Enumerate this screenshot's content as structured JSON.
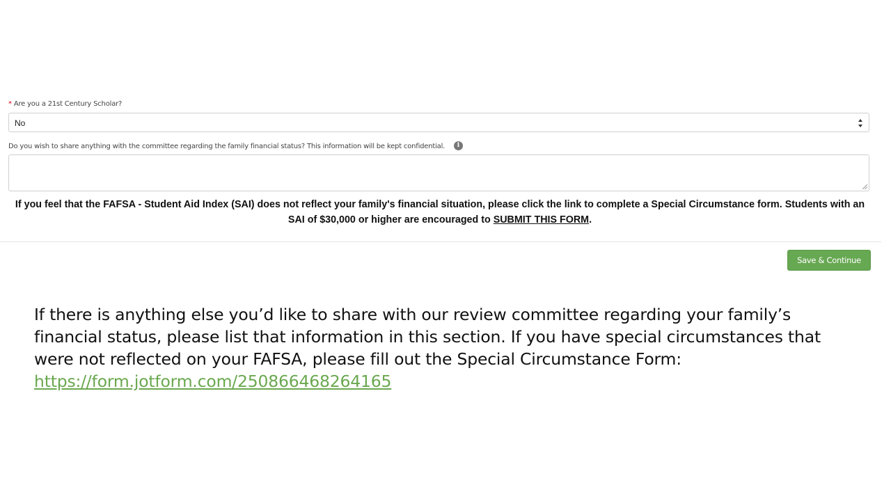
{
  "form": {
    "scholar_question": {
      "required_mark": "*",
      "label": "Are you a 21st Century Scholar?",
      "selected_value": "No"
    },
    "share_question": {
      "label": "Do you wish to share anything with the committee regarding the family financial status? This information will be kept confidential.",
      "info_icon": "i",
      "value": ""
    },
    "notice": {
      "text": "If you feel that the FAFSA - Student Aid Index (SAI) does not reflect your family's financial situation, please click the link to complete a Special Circumstance form. Students with an SAI of $30,000 or higher are encouraged to ",
      "link_text": "SUBMIT THIS FORM",
      "end": "."
    },
    "save_button": "Save & Continue"
  },
  "note": {
    "text": "If there is anything else you’d like to share with our review committee regarding your family’s financial status, please list that information in this section. If you have special circumstances that were not reflected on your FAFSA, please fill out the Special Circumstance Form: ",
    "link": "https://form.jotform.com/250866468264165"
  },
  "colors": {
    "accent_green": "#67a853",
    "link_green": "#6aa84f",
    "required_red": "#d0021b"
  }
}
